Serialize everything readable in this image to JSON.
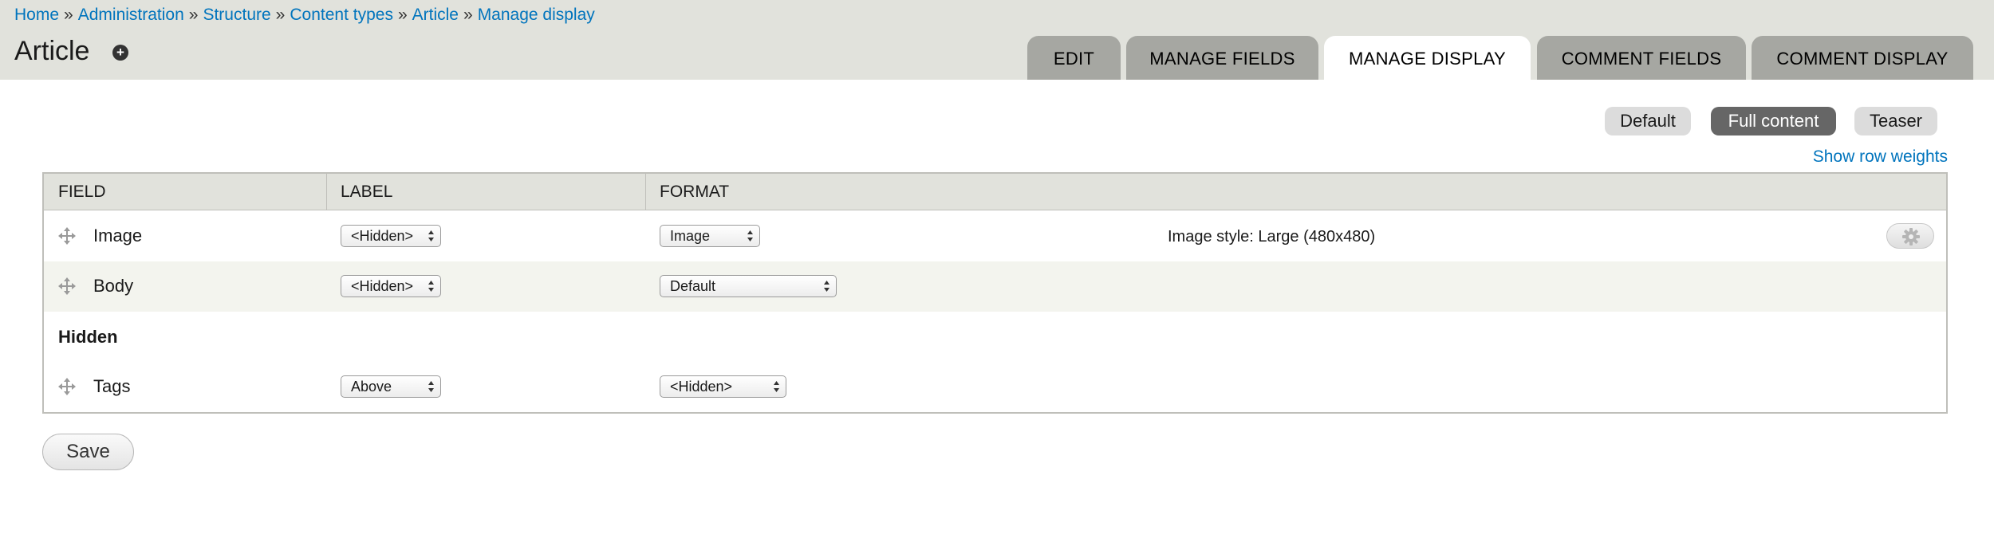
{
  "breadcrumb": [
    {
      "label": "Home"
    },
    {
      "label": "Administration"
    },
    {
      "label": "Structure"
    },
    {
      "label": "Content types"
    },
    {
      "label": "Article"
    },
    {
      "label": "Manage display"
    }
  ],
  "breadcrumb_separator": "»",
  "page": {
    "title": "Article",
    "shortcut_icon": "plus-circle-icon"
  },
  "tabs": [
    {
      "label": "EDIT",
      "active": false
    },
    {
      "label": "MANAGE FIELDS",
      "active": false
    },
    {
      "label": "MANAGE DISPLAY",
      "active": true
    },
    {
      "label": "COMMENT FIELDS",
      "active": false
    },
    {
      "label": "COMMENT DISPLAY",
      "active": false
    }
  ],
  "view_modes": [
    {
      "label": "Default",
      "active": false
    },
    {
      "label": "Full content",
      "active": true
    },
    {
      "label": "Teaser",
      "active": false
    }
  ],
  "row_weights_link": "Show row weights",
  "table": {
    "headers": [
      "FIELD",
      "LABEL",
      "FORMAT"
    ],
    "rows": [
      {
        "field": "Image",
        "label": "<Hidden>",
        "format": "Image",
        "summary": "Image style: Large (480x480)",
        "has_settings": true
      },
      {
        "field": "Body",
        "label": "<Hidden>",
        "format": "Default",
        "summary": "",
        "has_settings": false
      }
    ],
    "hidden_region_title": "Hidden",
    "hidden_rows": [
      {
        "field": "Tags",
        "label": "Above",
        "format": "<Hidden>"
      }
    ]
  },
  "save_label": "Save",
  "colors": {
    "link": "#0074bd",
    "header_bg": "#e1e2dc",
    "tab_inactive": "#a6a7a2",
    "pill_active": "#666666"
  }
}
